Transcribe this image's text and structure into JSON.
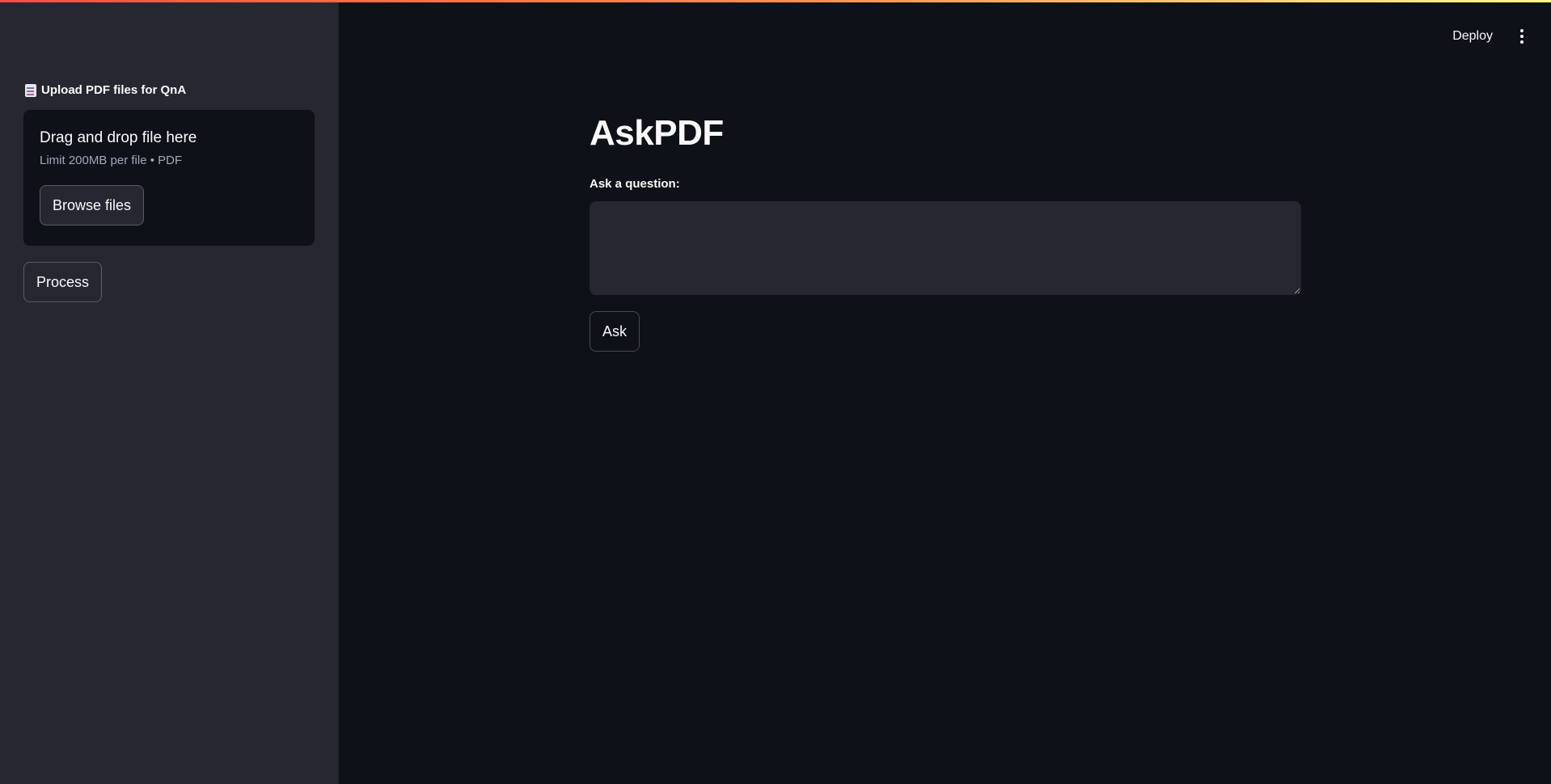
{
  "sidebar": {
    "uploader": {
      "label": "Upload PDF files for QnA",
      "label_icon": "document-icon",
      "drop_title": "Drag and drop file here",
      "drop_subtitle": "Limit 200MB per file • PDF",
      "browse_label": "Browse files"
    },
    "process_label": "Process"
  },
  "header": {
    "deploy_label": "Deploy",
    "menu_icon": "kebab-menu-icon"
  },
  "main": {
    "title": "AskPDF",
    "question_label": "Ask a question:",
    "question_value": "",
    "ask_label": "Ask"
  },
  "colors": {
    "background": "#0e1117",
    "sidebar": "#262730",
    "text": "#fafafa",
    "accent_gradient_start": "#ff4b4b",
    "accent_gradient_end": "#fffd80"
  }
}
